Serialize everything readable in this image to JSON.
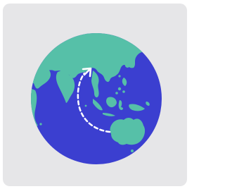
{
  "icon": {
    "name": "globe-travel-route-icon",
    "colors": {
      "card_background": "#e6e6e8",
      "ocean": "#3b3fd0",
      "land": "#56c0a8",
      "route": "#ffffff"
    }
  }
}
